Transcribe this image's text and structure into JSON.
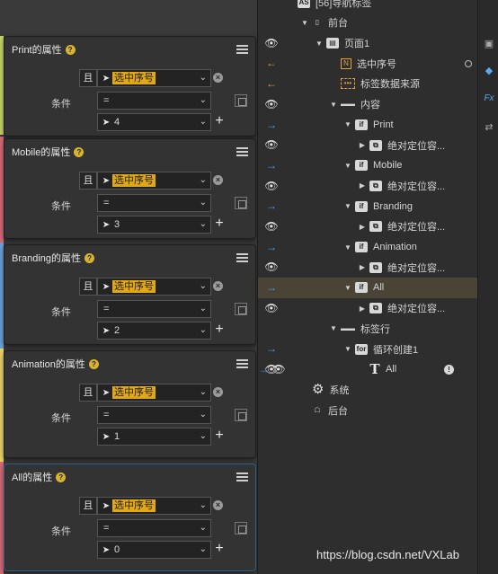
{
  "tree": {
    "nav_tag": "[56]导航标签",
    "rows": [
      {
        "label": "前台",
        "indent": 1,
        "icon": "phone",
        "eye": false,
        "arrow": "",
        "twisty": "down"
      },
      {
        "label": "页面1",
        "indent": 2,
        "icon": "page",
        "eye": true,
        "arrow": "",
        "twisty": "down"
      },
      {
        "label": "选中序号",
        "indent": 3,
        "icon": "bracket",
        "eye": false,
        "arrow": "left",
        "twisty": ""
      },
      {
        "label": "标签数据来源",
        "indent": 3,
        "icon": "dots",
        "eye": false,
        "arrow": "left",
        "twisty": ""
      },
      {
        "label": "内容",
        "indent": 3,
        "icon": "panel",
        "eye": true,
        "arrow": "",
        "twisty": "down"
      },
      {
        "label": "Print",
        "indent": 4,
        "icon": "if",
        "eye": false,
        "arrow": "right",
        "twisty": "down"
      },
      {
        "label": "绝对定位容...",
        "indent": 5,
        "icon": "container",
        "eye": true,
        "arrow": "",
        "twisty": "right"
      },
      {
        "label": "Mobile",
        "indent": 4,
        "icon": "if",
        "eye": false,
        "arrow": "right",
        "twisty": "down"
      },
      {
        "label": "绝对定位容...",
        "indent": 5,
        "icon": "container",
        "eye": true,
        "arrow": "",
        "twisty": "right"
      },
      {
        "label": "Branding",
        "indent": 4,
        "icon": "if",
        "eye": false,
        "arrow": "right",
        "twisty": "down"
      },
      {
        "label": "绝对定位容...",
        "indent": 5,
        "icon": "container",
        "eye": true,
        "arrow": "",
        "twisty": "right"
      },
      {
        "label": "Animation",
        "indent": 4,
        "icon": "if",
        "eye": false,
        "arrow": "right",
        "twisty": "down"
      },
      {
        "label": "绝对定位容...",
        "indent": 5,
        "icon": "container",
        "eye": true,
        "arrow": "",
        "twisty": "right"
      },
      {
        "label": "All",
        "indent": 4,
        "icon": "if",
        "eye": false,
        "arrow": "right",
        "twisty": "down",
        "selected": true
      },
      {
        "label": "绝对定位容...",
        "indent": 5,
        "icon": "container",
        "eye": true,
        "arrow": "",
        "twisty": "right"
      },
      {
        "label": "标签行",
        "indent": 3,
        "icon": "panel",
        "eye": false,
        "arrow": "",
        "twisty": "down"
      },
      {
        "label": "循环创建1",
        "indent": 4,
        "icon": "for",
        "eye": false,
        "arrow": "right",
        "twisty": "down"
      },
      {
        "label": "All",
        "indent": 5,
        "icon": "text",
        "eye": true,
        "arrow": "right",
        "twisty": "",
        "info": true
      },
      {
        "label": "系统",
        "indent": 1,
        "icon": "gear",
        "eye": false,
        "arrow": "",
        "twisty": ""
      },
      {
        "label": "后台",
        "indent": 1,
        "icon": "server",
        "eye": false,
        "arrow": "",
        "twisty": ""
      }
    ]
  },
  "panels": [
    {
      "title": "Print的属性",
      "and_label": "且",
      "field": "选中序号",
      "condition_label": "条件",
      "operator": "=",
      "value": "4",
      "accent": "#c8d46a"
    },
    {
      "title": "Mobile的属性",
      "and_label": "且",
      "field": "选中序号",
      "condition_label": "条件",
      "operator": "=",
      "value": "3",
      "accent": "#d36a78"
    },
    {
      "title": "Branding的属性",
      "and_label": "且",
      "field": "选中序号",
      "condition_label": "条件",
      "operator": "=",
      "value": "2",
      "accent": "#6aa0d6"
    },
    {
      "title": "Animation的属性",
      "and_label": "且",
      "field": "选中序号",
      "condition_label": "条件",
      "operator": "=",
      "value": "1",
      "accent": "#e9d26a"
    },
    {
      "title": "All的属性",
      "and_label": "且",
      "field": "选中序号",
      "condition_label": "条件",
      "operator": "=",
      "value": "0",
      "accent": "#d36a78"
    }
  ],
  "watermark": "https://blog.csdn.net/VXLab",
  "colors": {
    "highlight": "#e0a817",
    "arrow_in": "#e0a030",
    "arrow_out": "#4aa0f0",
    "selected_row": "#4a4436"
  }
}
